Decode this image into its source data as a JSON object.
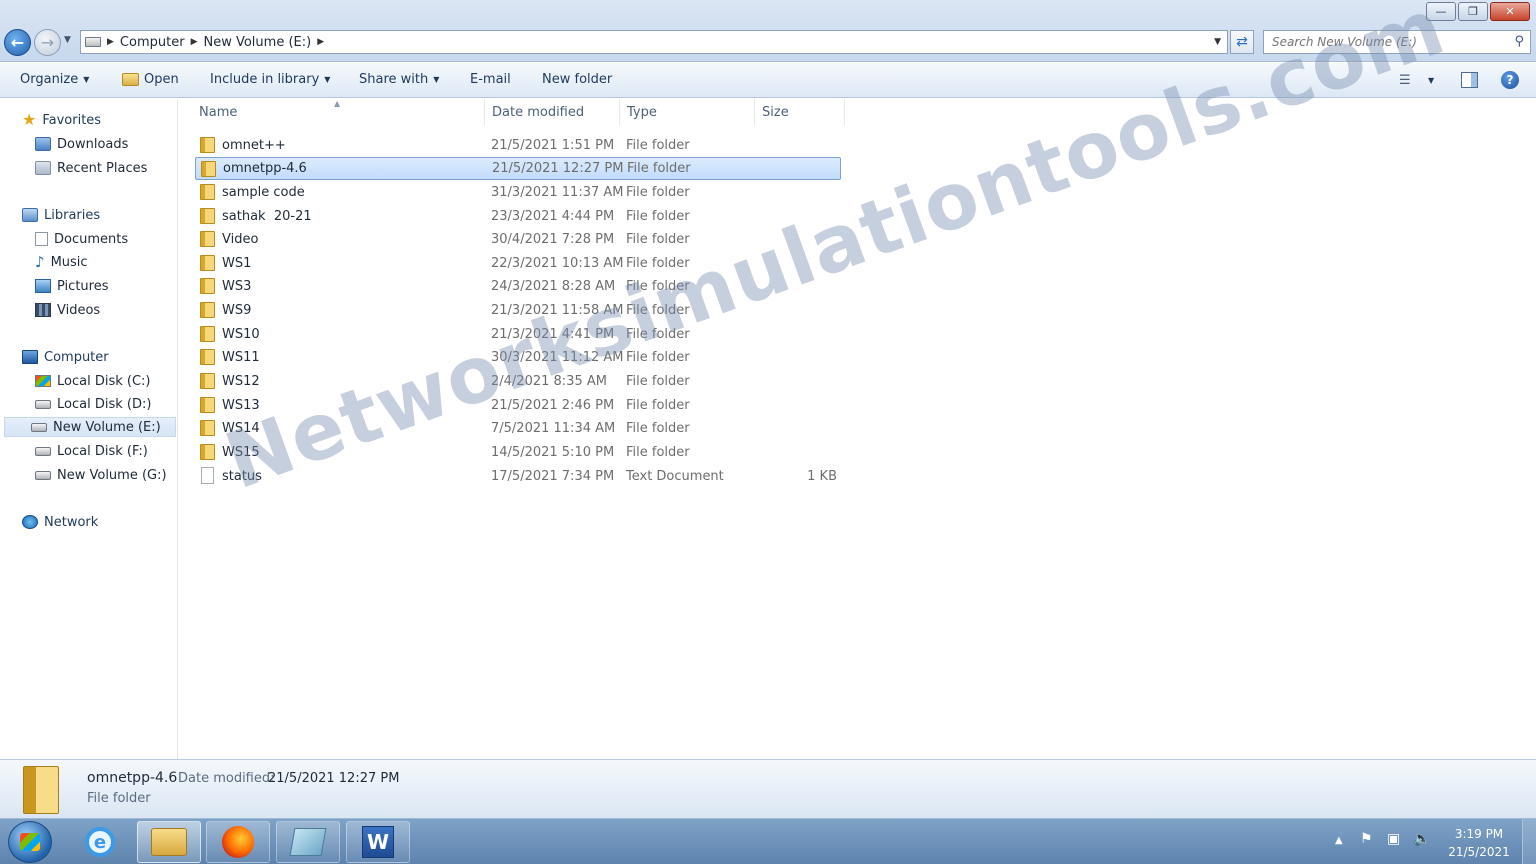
{
  "window": {
    "minimize_icon": "minimize-icon",
    "maximize_icon": "restore-icon",
    "close_icon": "close-icon"
  },
  "address_bar": {
    "crumbs": [
      "Computer",
      "New Volume (E:)"
    ],
    "search_placeholder": "Search New Volume (E:)"
  },
  "command_bar": {
    "organize": "Organize",
    "open": "Open",
    "include_in_library": "Include in library",
    "share_with": "Share with",
    "email": "E-mail",
    "new_folder": "New folder"
  },
  "nav_pane": {
    "favorites": "Favorites",
    "downloads": "Downloads",
    "recent_places": "Recent Places",
    "libraries": "Libraries",
    "documents": "Documents",
    "music": "Music",
    "pictures": "Pictures",
    "videos": "Videos",
    "computer": "Computer",
    "drives": [
      "Local Disk (C:)",
      "Local Disk (D:)",
      "New Volume (E:)",
      "Local Disk (F:)",
      "New Volume (G:)"
    ],
    "network": "Network",
    "selected": "New Volume (E:)"
  },
  "file_list": {
    "columns": [
      "Name",
      "Date modified",
      "Type",
      "Size"
    ],
    "rows": [
      {
        "name": "omnet++",
        "date": "21/5/2021 1:51 PM",
        "type": "File folder",
        "size": ""
      },
      {
        "name": "omnetpp-4.6",
        "date": "21/5/2021 12:27 PM",
        "type": "File folder",
        "size": ""
      },
      {
        "name": "sample code",
        "date": "31/3/2021 11:37 AM",
        "type": "File folder",
        "size": ""
      },
      {
        "name": "sathak  20-21",
        "date": "23/3/2021 4:44 PM",
        "type": "File folder",
        "size": ""
      },
      {
        "name": "Video",
        "date": "30/4/2021 7:28 PM",
        "type": "File folder",
        "size": ""
      },
      {
        "name": "WS1",
        "date": "22/3/2021 10:13 AM",
        "type": "File folder",
        "size": ""
      },
      {
        "name": "WS3",
        "date": "24/3/2021 8:28 AM",
        "type": "File folder",
        "size": ""
      },
      {
        "name": "WS9",
        "date": "21/3/2021 11:58 AM",
        "type": "File folder",
        "size": ""
      },
      {
        "name": "WS10",
        "date": "21/3/2021 4:41 PM",
        "type": "File folder",
        "size": ""
      },
      {
        "name": "WS11",
        "date": "30/3/2021 11:12 AM",
        "type": "File folder",
        "size": ""
      },
      {
        "name": "WS12",
        "date": "2/4/2021 8:35 AM",
        "type": "File folder",
        "size": ""
      },
      {
        "name": "WS13",
        "date": "21/5/2021 2:46 PM",
        "type": "File folder",
        "size": ""
      },
      {
        "name": "WS14",
        "date": "7/5/2021 11:34 AM",
        "type": "File folder",
        "size": ""
      },
      {
        "name": "WS15",
        "date": "14/5/2021 5:10 PM",
        "type": "File folder",
        "size": ""
      },
      {
        "name": "status",
        "date": "17/5/2021 7:34 PM",
        "type": "Text Document",
        "size": "1 KB"
      }
    ],
    "selected_row": 1
  },
  "details_pane": {
    "name": "omnetpp-4.6",
    "date_label": "Date modified:",
    "date_value": "21/5/2021 12:27 PM",
    "type": "File folder"
  },
  "watermark": "Networksimulationtools.com",
  "taskbar": {
    "time": "3:19 PM",
    "date": "21/5/2021",
    "word_letter": "W",
    "ie_letter": "e"
  },
  "colors": {
    "selection": "#c1dcfc",
    "taskbar": "#6a8fb8",
    "accent": "#1e395b"
  }
}
